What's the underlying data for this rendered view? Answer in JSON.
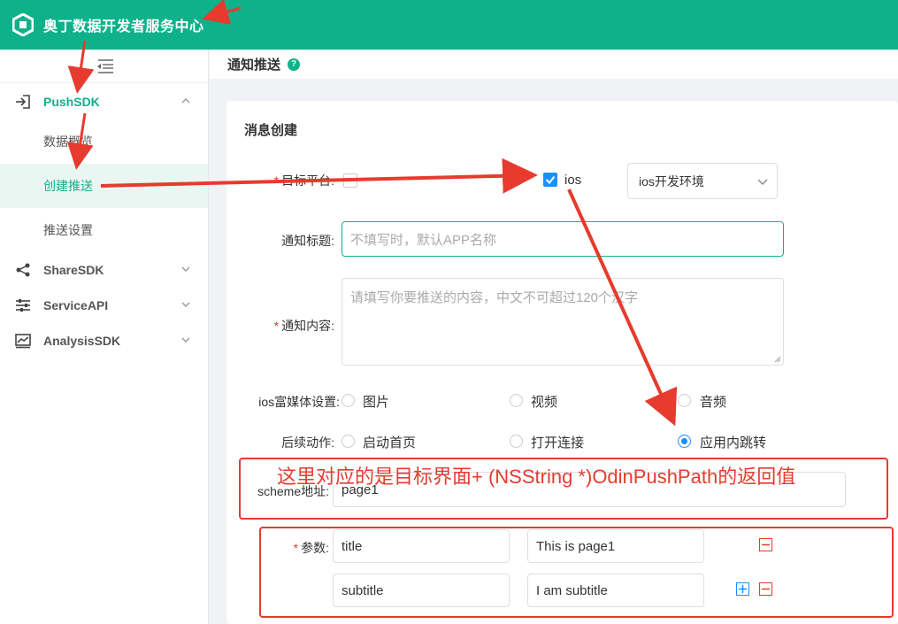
{
  "app": {
    "title": "奥丁数据开发者服务中心"
  },
  "sidebar": {
    "groups": [
      {
        "label": "PushSDK",
        "icon": "login-icon",
        "expanded": true,
        "items": [
          {
            "label": "数据概览"
          },
          {
            "label": "创建推送"
          },
          {
            "label": "推送设置"
          }
        ]
      },
      {
        "label": "ShareSDK",
        "icon": "share-icon"
      },
      {
        "label": "ServiceAPI",
        "icon": "sliders-icon"
      },
      {
        "label": "AnalysisSDK",
        "icon": "chart-icon"
      }
    ]
  },
  "header": {
    "title": "通知推送"
  },
  "form": {
    "card_title": "消息创建",
    "target_platform": {
      "label": "目标平台:",
      "ios_label": "ios",
      "env_value": "ios开发环境"
    },
    "notify_title": {
      "label": "通知标题:",
      "placeholder": "不填写时，默认APP名称"
    },
    "notify_content": {
      "label": "通知内容:",
      "placeholder": "请填写你要推送的内容，中文不可超过120个汉字"
    },
    "rich_media": {
      "label": "ios富媒体设置:",
      "options": [
        "图片",
        "视频",
        "音频"
      ]
    },
    "follow_action": {
      "label": "后续动作:",
      "options": [
        "启动首页",
        "打开连接",
        "应用内跳转"
      ]
    },
    "scheme": {
      "label": "scheme地址:",
      "value": "page1"
    },
    "params": {
      "label": "参数:",
      "rows": [
        {
          "key": "title",
          "value": "This is page1"
        },
        {
          "key": "subtitle",
          "value": "I am subtitle"
        }
      ]
    }
  },
  "annotation": {
    "text": "这里对应的是目标界面+ (NSString *)OdinPushPath的返回值"
  },
  "colors": {
    "brand": "#0fb18a",
    "annotation": "#e63b2e",
    "checkbox": "#1890ff"
  }
}
